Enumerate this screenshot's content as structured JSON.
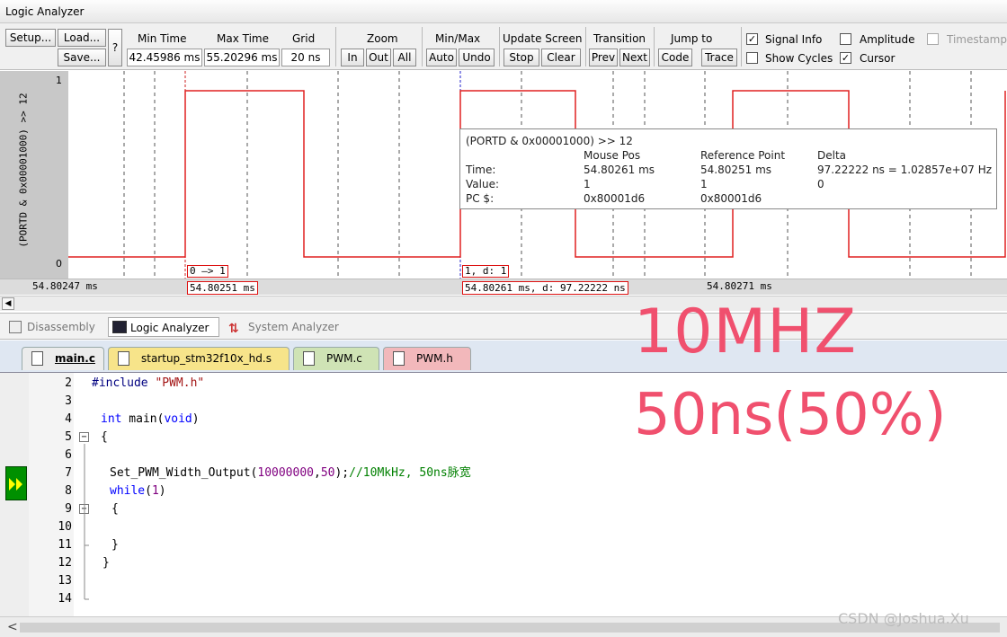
{
  "window": {
    "title": "Logic Analyzer"
  },
  "toolbar": {
    "setup": "Setup...",
    "load": "Load...",
    "save": "Save...",
    "help": "?",
    "min_time_label": "Min Time",
    "min_time_value": "42.45986 ms",
    "max_time_label": "Max Time",
    "max_time_value": "55.20296 ms",
    "grid_label": "Grid",
    "grid_value": "20 ns",
    "zoom_label": "Zoom",
    "zoom_in": "In",
    "zoom_out": "Out",
    "zoom_all": "All",
    "minmax_label": "Min/Max",
    "auto": "Auto",
    "undo": "Undo",
    "update_label": "Update Screen",
    "stop": "Stop",
    "clear": "Clear",
    "transition_label": "Transition",
    "prev": "Prev",
    "next": "Next",
    "jump_label": "Jump to",
    "code": "Code",
    "trace": "Trace",
    "signal_info": "Signal Info",
    "signal_info_checked": true,
    "show_cycles": "Show Cycles",
    "show_cycles_checked": false,
    "amplitude": "Amplitude",
    "amplitude_checked": false,
    "cursor": "Cursor",
    "cursor_checked": true,
    "timestamps": "Timestamps",
    "timestamps_checked": false
  },
  "plot": {
    "signal_label": "(PORTD & 0x00001000) >> 12",
    "y_high": "1",
    "y_low": "0",
    "time_left": "54.80247 ms",
    "time_ref": "54.80251 ms",
    "time_cursor": "54.80261 ms,  d: 97.22222 ns",
    "time_right": "54.80271 ms",
    "marker_ref": "0 —> 1",
    "marker_cursor": "1,  d: 1",
    "signal_color": "#e02020"
  },
  "info_popup": {
    "title": "(PORTD & 0x00001000) >> 12",
    "col_mouse": "Mouse Pos",
    "col_ref": "Reference Point",
    "col_delta": "Delta",
    "row_time": "Time:",
    "row_value": "Value:",
    "row_pc": "PC $:",
    "mouse_time": "54.80261 ms",
    "ref_time": "54.80251 ms",
    "delta_time": "97.22222 ns = 1.02857e+07 Hz",
    "mouse_value": "1",
    "ref_value": "1",
    "delta_value": "0",
    "mouse_pc": "0x80001d6",
    "ref_pc": "0x80001d6"
  },
  "view_tabs": [
    "Disassembly",
    "Logic Analyzer",
    "System Analyzer"
  ],
  "file_tabs": [
    {
      "name": "main.c",
      "color": "#e9e9e9"
    },
    {
      "name": "startup_stm32f10x_hd.s",
      "color": "#f7e48a"
    },
    {
      "name": "PWM.c",
      "color": "#cfe3b5"
    },
    {
      "name": "PWM.h",
      "color": "#f2b8bb"
    }
  ],
  "code_lines": {
    "l2": {
      "num": "2",
      "pp": "#include ",
      "str": "\"PWM.h\""
    },
    "l3": {
      "num": "3"
    },
    "l4": {
      "num": "4",
      "kw": "int",
      "rest": " main(",
      "kw2": "void",
      "end": ")"
    },
    "l5": {
      "num": "5",
      "text": "{"
    },
    "l6": {
      "num": "6"
    },
    "l7": {
      "num": "7",
      "fn": "Set_PWM_Width_Output(",
      "n1": "10000000",
      "comma": ",",
      "n2": "50",
      "end": ");",
      "cm": "//10MkHz, 50ns脉宽"
    },
    "l8": {
      "num": "8",
      "kw": "while",
      "p1": "(",
      "n": "1",
      "p2": ")"
    },
    "l9": {
      "num": "9",
      "text": "{"
    },
    "l10": {
      "num": "10"
    },
    "l11": {
      "num": "11",
      "text": "}"
    },
    "l12": {
      "num": "12",
      "text": "}"
    },
    "l13": {
      "num": "13"
    },
    "l14": {
      "num": "14"
    }
  },
  "overlay": {
    "line1": "10MHZ",
    "line2": "50ns(50%)"
  },
  "watermark": "CSDN @Joshua.Xu"
}
